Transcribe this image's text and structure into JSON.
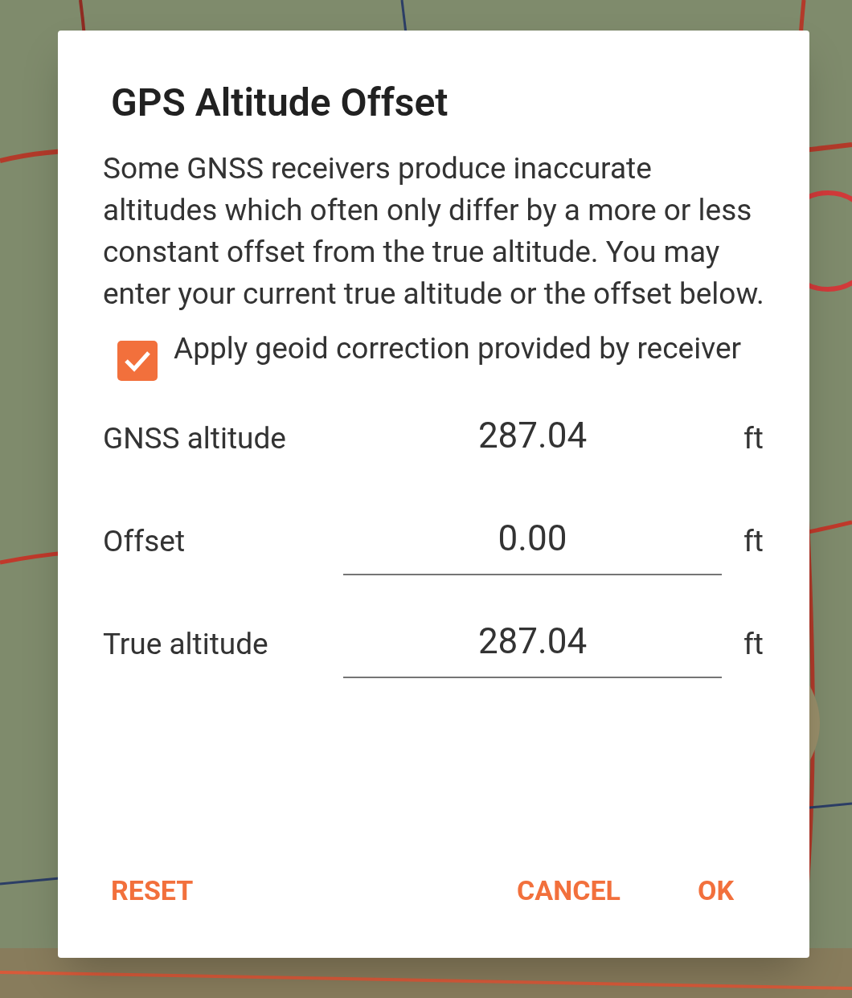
{
  "dialog": {
    "title": "GPS Altitude Offset",
    "message": "Some GNSS receivers produce inaccurate altitudes which often only differ by a more or less constant offset from the true altitude. You may enter your current true altitude or the offset below.",
    "checkbox": {
      "label": "Apply geoid correction provided by receiver",
      "checked": true
    },
    "fields": [
      {
        "label": "GNSS altitude",
        "value": "287.04",
        "unit": "ft",
        "kind": "readout"
      },
      {
        "label": "Offset",
        "value": "0.00",
        "unit": "ft",
        "kind": "input"
      },
      {
        "label": "True altitude",
        "value": "287.04",
        "unit": "ft",
        "kind": "input"
      }
    ],
    "buttons": [
      {
        "label": "RESET"
      },
      {
        "label": "CANCEL"
      },
      {
        "label": "OK"
      }
    ]
  }
}
